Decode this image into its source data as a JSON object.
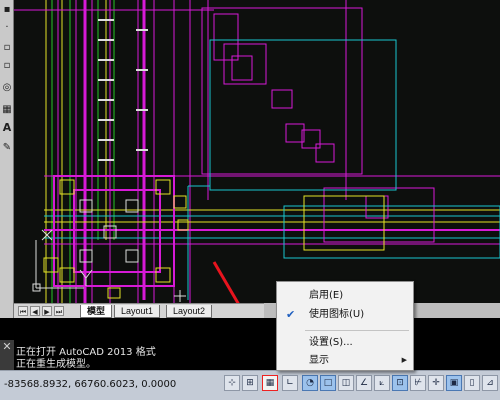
{
  "layout_tabs": [
    "模型",
    "Layout1",
    "Layout2"
  ],
  "tab_nav": [
    "⏮",
    "◀",
    "▶",
    "⏭"
  ],
  "command_lines": [
    "正在打开 AutoCAD 2013 格式",
    "正在重生成模型。"
  ],
  "status": {
    "coordinates": "-83568.8932, 66760.6023, 0.0000"
  },
  "context_menu": {
    "items": [
      {
        "label": "启用(E)",
        "checked": false,
        "submenu": false
      },
      {
        "label": "使用图标(U)",
        "checked": true,
        "submenu": false
      },
      {
        "label": "设置(S)...",
        "checked": false,
        "submenu": false
      },
      {
        "label": "显示",
        "checked": false,
        "submenu": true
      }
    ]
  },
  "colors": {
    "magenta": "#d61ad6",
    "cyan": "#19c5cf",
    "yellow": "#e3e326",
    "green": "#27c427",
    "annotation_red": "#e8141e"
  }
}
